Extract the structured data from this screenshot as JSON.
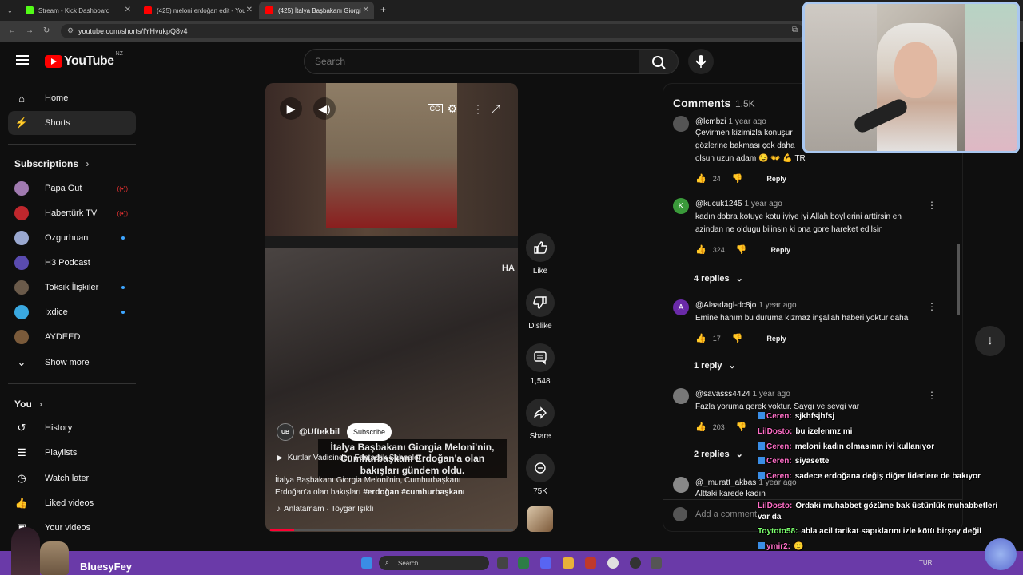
{
  "browser": {
    "tabs": [
      {
        "title": "Stream - Kick Dashboard",
        "color": "#53fc18"
      },
      {
        "title": "(425) meloni erdoğan edit - You",
        "color": "#ff0000"
      },
      {
        "title": "(425) İtalya Başbakanı Giorgia M",
        "color": "#ff0000"
      }
    ],
    "url": "youtube.com/shorts/fYHvukpQ8v4"
  },
  "header": {
    "logo": "YouTube",
    "country": "NZ",
    "search_placeholder": "Search"
  },
  "sidebar": {
    "nav": [
      {
        "label": "Home",
        "icon": "home-icon"
      },
      {
        "label": "Shorts",
        "icon": "shorts-icon"
      }
    ],
    "subscriptions_heading": "Subscriptions",
    "subscriptions": [
      {
        "label": "Papa Gut",
        "status": "live",
        "color": "#a07ab0"
      },
      {
        "label": "Habertürk TV",
        "status": "live",
        "color": "#c0272d"
      },
      {
        "label": "Ozgurhuan",
        "status": "",
        "color": "#9aa8d0"
      },
      {
        "label": "H3 Podcast",
        "status": "",
        "color": "#5a4bb0"
      },
      {
        "label": "Toksik İlişkiler",
        "status": "new",
        "color": "#6a5a4a"
      },
      {
        "label": "Ixdice",
        "status": "new",
        "color": "#3aa8e0"
      },
      {
        "label": "AYDEED",
        "status": "",
        "color": "#7a5a3a"
      }
    ],
    "show_more": "Show more",
    "you_heading": "You",
    "you_items": [
      {
        "label": "History",
        "icon": "history-icon"
      },
      {
        "label": "Playlists",
        "icon": "playlists-icon"
      },
      {
        "label": "Watch later",
        "icon": "watch-later-icon"
      },
      {
        "label": "Liked videos",
        "icon": "liked-videos-icon"
      },
      {
        "label": "Your videos",
        "icon": "your-videos-icon"
      }
    ]
  },
  "video": {
    "overlay_right": "HA",
    "overlay_text": "İtalya Başbakanı Giorgia Meloni'nin, Cumhurbaşkanı Erdoğan'a olan bakışları gündem oldu.",
    "channel": "@Uftekbil",
    "channel_avatar": "UB",
    "subscribe": "Subscribe",
    "playlist": "Kurtlar Vadisinden Fantastik Sahneler",
    "description_prefix": "İtalya Başbakanı Giorgia Meloni'nin, Cumhurbaşkanı Erdoğan'a olan bakışları ",
    "tag1": "#erdoğan",
    "tag2": "#cumhurbaşkanı",
    "music": "Anlatamam · Toygar Işıklı",
    "progress": 0.1
  },
  "actions": {
    "like": "Like",
    "dislike": "Dislike",
    "comments": "1,548",
    "share": "Share",
    "remix": "75K"
  },
  "comments": {
    "title": "Comments",
    "count": "1.5K",
    "items": [
      {
        "author": "@lcmbzi",
        "time": "1 year ago",
        "lines": [
          "Çevirmen kizimizla konuşur",
          "gözlerine bakması çok daha",
          "olsun uzun adam 😉 👐 💪 TR"
        ],
        "likes": "24",
        "avatar_color": "#555",
        "initial": ""
      },
      {
        "author": "@kucuk1245",
        "time": "1 year ago",
        "lines": [
          "kadın dobra kotuye kotu iyiye iyi Allah boyllerini arttirsin en",
          "azindan ne oldugu bilinsin ki ona gore hareket edilsin"
        ],
        "likes": "324",
        "avatar_color": "#3a9a3a",
        "initial": "K",
        "replies": "4 replies"
      },
      {
        "author": "@Alaadagl-dc8jo",
        "time": "1 year ago",
        "lines": [
          "Emine hanım bu duruma kızmaz inşallah haberi yoktur daha"
        ],
        "likes": "17",
        "avatar_color": "#6a2aa8",
        "initial": "A",
        "replies": "1 reply"
      },
      {
        "author": "@savasss4424",
        "time": "1 year ago",
        "lines": [
          "Fazla yoruma gerek yoktur. Saygı ve sevgi var"
        ],
        "likes": "203",
        "avatar_color": "#777",
        "initial": "",
        "replies": "2 replies"
      },
      {
        "author": "@_muratt_akbas",
        "time": "1 year ago",
        "lines": [
          "Alttaki karede kadın"
        ],
        "likes": "",
        "avatar_color": "#888",
        "initial": ""
      }
    ],
    "reply": "Reply",
    "add_placeholder": "Add a comment..."
  },
  "chat": [
    {
      "name": "Ceren:",
      "text": "sjkhfsjhfsj",
      "cls": "nm-ceren",
      "badge": true
    },
    {
      "name": "LilDosto:",
      "text": "bu izelenmz mi",
      "cls": "nm-lil",
      "badge": false
    },
    {
      "name": "Ceren:",
      "text": "meloni kadın olmasının iyi kullanıyor",
      "cls": "nm-ceren",
      "badge": true
    },
    {
      "name": "Ceren:",
      "text": "siyasette",
      "cls": "nm-ceren",
      "badge": true
    },
    {
      "name": "Ceren:",
      "text": "sadece erdoğana değiş diğer liderlere de bakıyor",
      "cls": "nm-ceren",
      "badge": true
    },
    {
      "name": "LilDosto:",
      "text": "Ordaki muhabbet gözüme bak üstünlük muhabbetleri",
      "cls": "nm-lil",
      "badge": false
    },
    {
      "name": "",
      "text": "var da",
      "cls": "nm-lil",
      "badge": false
    },
    {
      "name": "Toytoto58:",
      "text": "abla acil tarikat sapıklarını izle kötü birşey değil",
      "cls": "nm-toy",
      "badge": false
    },
    {
      "name": "ymir2:",
      "text": "",
      "cls": "nm-ym",
      "badge": true
    }
  ],
  "streamer": {
    "name": "BluesyFey"
  },
  "taskbar": {
    "search": "Search",
    "lang": "TUR"
  }
}
